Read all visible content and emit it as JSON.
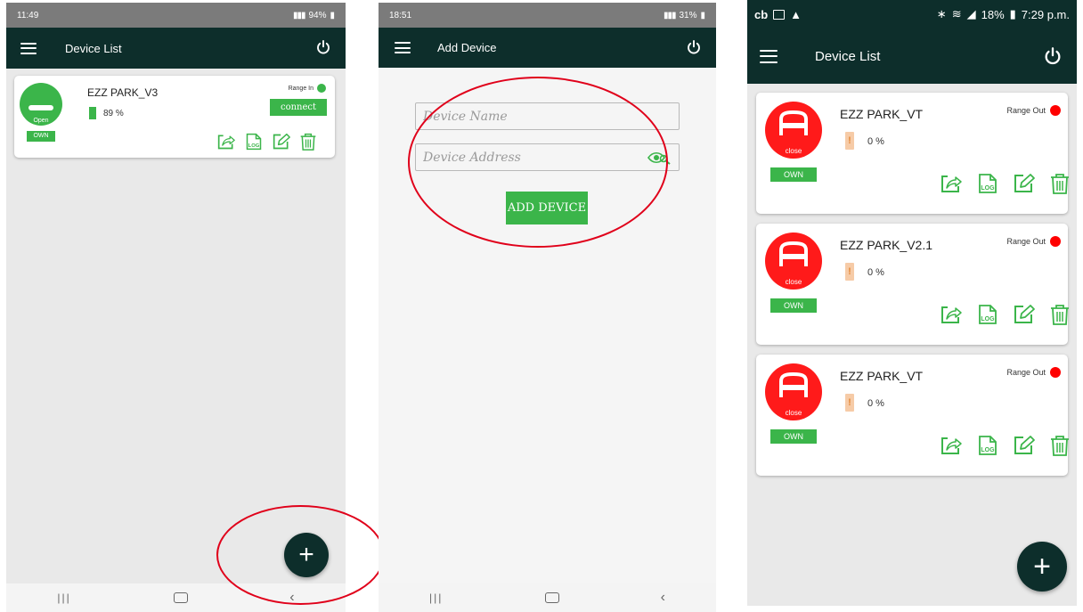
{
  "left_screen": {
    "status_time": "11:49",
    "status_right": "94%",
    "app_title": "Device List",
    "device": {
      "name": "EZZ PARK_V3",
      "battery": "89 %",
      "battery_level": 0.89,
      "status_label": "Open",
      "ownership": "OWN",
      "range": "Range In",
      "connect_label": "connect",
      "log_label": "LOG"
    },
    "fab_label": "+"
  },
  "middle_screen": {
    "status_time": "18:51",
    "status_right": "31%",
    "app_title": "Add Device",
    "device_name_placeholder": "Device Name",
    "device_address_placeholder": "Device Address",
    "add_button_label": "ADD DEVICE"
  },
  "right_screen": {
    "status_left": "cb",
    "status_right": "18%",
    "status_time": "7:29 p.m.",
    "app_title": "Device List",
    "devices": [
      {
        "name": "EZZ PARK_VT",
        "battery": "0 %",
        "status_label": "close",
        "ownership": "OWN",
        "range": "Range Out",
        "log_label": "LOG"
      },
      {
        "name": "EZZ PARK_V2.1",
        "battery": "0 %",
        "status_label": "close",
        "ownership": "OWN",
        "range": "Range Out",
        "log_label": "LOG"
      },
      {
        "name": "EZZ PARK_VT",
        "battery": "0 %",
        "status_label": "close",
        "ownership": "OWN",
        "range": "Range Out",
        "log_label": "LOG"
      }
    ],
    "fab_label": "+"
  },
  "colors": {
    "appbar": "#0d2e2b",
    "accent_green": "#3bb54a",
    "alert_red": "#e0001a",
    "range_in_dot": "#3bb54a",
    "range_out_dot": "#ff0000"
  },
  "navbar_icons": [
    "recents-icon",
    "home-icon",
    "back-icon"
  ]
}
